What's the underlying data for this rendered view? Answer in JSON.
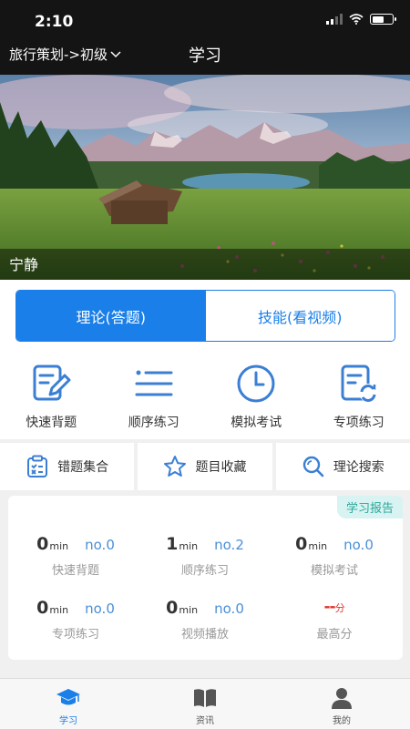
{
  "status": {
    "time": "2:10"
  },
  "nav": {
    "category": "旅行策划->初级",
    "title": "学习"
  },
  "banner": {
    "caption": "宁静"
  },
  "mode_toggle": {
    "theory": "理论(答题)",
    "skill": "技能(看视频)"
  },
  "features": [
    {
      "label": "快速背题",
      "icon": "edit-note-icon"
    },
    {
      "label": "顺序练习",
      "icon": "list-icon"
    },
    {
      "label": "模拟考试",
      "icon": "clock-icon"
    },
    {
      "label": "专项练习",
      "icon": "refresh-doc-icon"
    }
  ],
  "tools": [
    {
      "label": "错题集合",
      "icon": "clipboard-x-icon"
    },
    {
      "label": "题目收藏",
      "icon": "star-icon"
    },
    {
      "label": "理论搜索",
      "icon": "search-icon"
    }
  ],
  "report": {
    "badge": "学习报告",
    "stats": [
      {
        "value": "0",
        "unit": "min",
        "rank": "no.0",
        "label": "快速背题"
      },
      {
        "value": "1",
        "unit": "min",
        "rank": "no.2",
        "label": "顺序练习"
      },
      {
        "value": "0",
        "unit": "min",
        "rank": "no.0",
        "label": "模拟考试"
      },
      {
        "value": "0",
        "unit": "min",
        "rank": "no.0",
        "label": "专项练习"
      },
      {
        "value": "0",
        "unit": "min",
        "rank": "no.0",
        "label": "视频播放"
      },
      {
        "value": "--",
        "unit": "分",
        "rank": "",
        "label": "最高分"
      }
    ]
  },
  "tabbar": [
    {
      "label": "学习",
      "icon": "graduation-cap-icon",
      "active": true
    },
    {
      "label": "资讯",
      "icon": "book-icon",
      "active": false
    },
    {
      "label": "我的",
      "icon": "user-icon",
      "active": false
    }
  ],
  "colors": {
    "accent": "#1a7fe8",
    "icon_blue": "#3b7fd4",
    "rank_blue": "#4a8fd8",
    "teal": "#2aa89a",
    "red": "#e0352b"
  }
}
